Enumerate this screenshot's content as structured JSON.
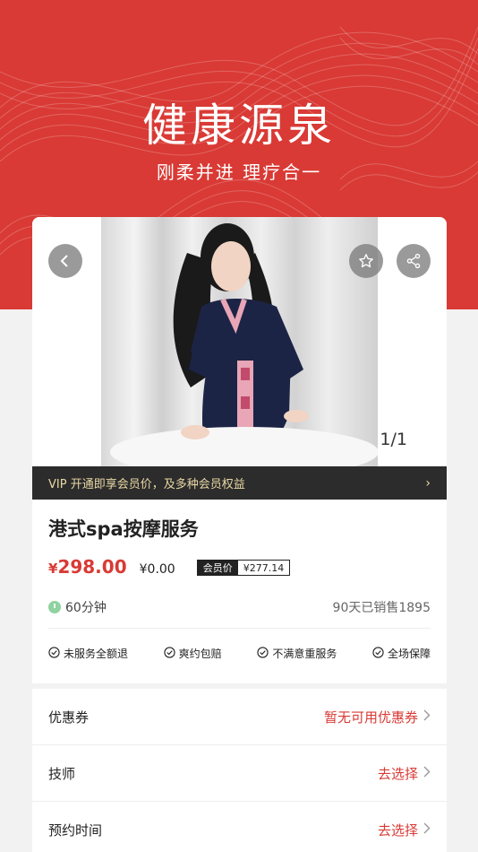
{
  "hero": {
    "title": "健康源泉",
    "subtitle": "刚柔并进  理疗合一"
  },
  "gallery": {
    "counter": "1/1",
    "back_icon": "chevron-left-icon",
    "favorite_icon": "star-icon",
    "share_icon": "share-icon"
  },
  "vip": {
    "text": "VIP 开通即享会员价，及多种会员权益",
    "chevron": "›"
  },
  "product": {
    "title": "港式spa按摩服务",
    "price_symbol": "¥",
    "price": "298.00",
    "original_price": "¥0.00",
    "member_label": "会员价",
    "member_price": "¥277.14",
    "duration": "60分钟",
    "sales": "90天已销售1895"
  },
  "guarantees": [
    {
      "label": "未服务全额退"
    },
    {
      "label": "爽约包赔"
    },
    {
      "label": "不满意重服务"
    },
    {
      "label": "全场保障"
    }
  ],
  "options": [
    {
      "label": "优惠券",
      "value": "暂无可用优惠券"
    },
    {
      "label": "技师",
      "value": "去选择"
    },
    {
      "label": "预约时间",
      "value": "去选择"
    }
  ],
  "colors": {
    "brand_red": "#d93a35",
    "vip_bar": "#2c2c2c",
    "vip_text": "#e9d7a5"
  }
}
